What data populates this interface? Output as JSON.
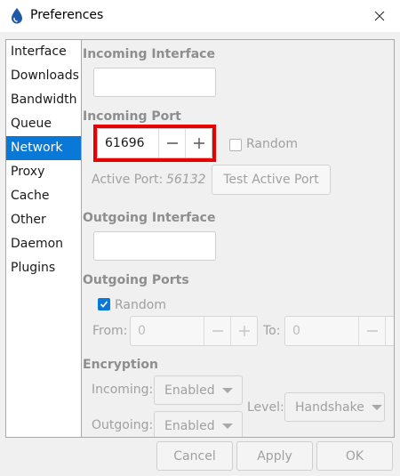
{
  "window": {
    "title": "Preferences",
    "app_icon": "water-drop-icon",
    "close_icon": "close-icon"
  },
  "sidebar": {
    "items": [
      {
        "label": "Interface"
      },
      {
        "label": "Downloads"
      },
      {
        "label": "Bandwidth"
      },
      {
        "label": "Queue"
      },
      {
        "label": "Network",
        "selected": true
      },
      {
        "label": "Proxy"
      },
      {
        "label": "Cache"
      },
      {
        "label": "Other"
      },
      {
        "label": "Daemon"
      },
      {
        "label": "Plugins"
      }
    ]
  },
  "network": {
    "incoming_interface": {
      "label": "Incoming Interface",
      "value": ""
    },
    "incoming_port": {
      "label": "Incoming Port",
      "value": "61696",
      "random_label": "Random",
      "random_checked": false,
      "active_port_label": "Active Port:",
      "active_port_value": "56132",
      "test_button": "Test Active Port"
    },
    "outgoing_interface": {
      "label": "Outgoing Interface",
      "value": ""
    },
    "outgoing_ports": {
      "label": "Outgoing Ports",
      "random_label": "Random",
      "random_checked": true,
      "from_label": "From:",
      "from_value": "0",
      "to_label": "To:",
      "to_value": "0"
    },
    "encryption": {
      "label": "Encryption",
      "incoming_label": "Incoming:",
      "incoming_value": "Enabled",
      "outgoing_label": "Outgoing:",
      "outgoing_value": "Enabled",
      "level_label": "Level:",
      "level_value": "Handshake"
    }
  },
  "footer": {
    "cancel": "Cancel",
    "apply": "Apply",
    "ok": "OK"
  },
  "colors": {
    "accent": "#0a78d7",
    "highlight": "#e60000"
  }
}
